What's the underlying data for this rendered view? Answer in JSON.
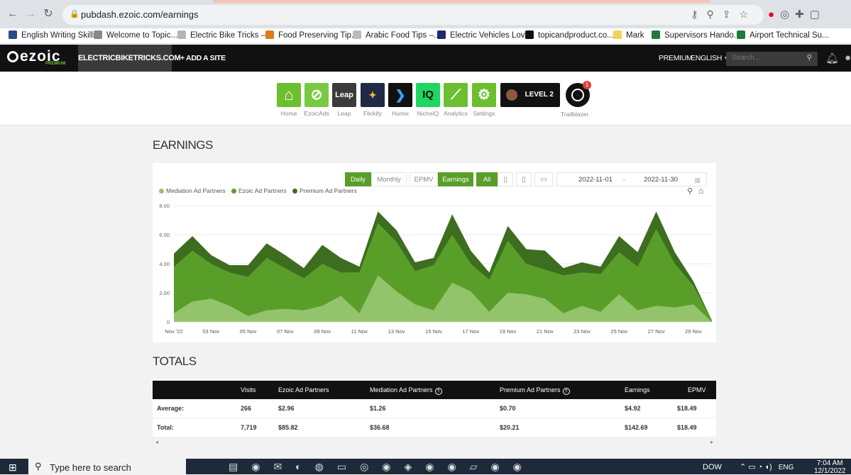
{
  "browser": {
    "url": "pubdash.ezoic.com/earnings",
    "bookmarks": [
      {
        "label": "English Writing Skills",
        "color": "#2b4a8a"
      },
      {
        "label": "Welcome to Topic...",
        "color": "#888888"
      },
      {
        "label": "Electric Bike Tricks –...",
        "color": "#b5b5b5"
      },
      {
        "label": "Food Preserving Tip...",
        "color": "#e07b1c"
      },
      {
        "label": "Arabic Food Tips –...",
        "color": "#bbbbbb"
      },
      {
        "label": "Electric Vehicles Lov...",
        "color": "#1d2b6b"
      },
      {
        "label": "topicandproduct.co...",
        "color": "#111111"
      },
      {
        "label": "Mark",
        "color": "#f2d35a"
      },
      {
        "label": "Supervisors Hando...",
        "color": "#1e7b3c"
      },
      {
        "label": "Airport Technical Su...",
        "color": "#1e7b3c"
      }
    ]
  },
  "header": {
    "logo": "ezoic",
    "logo_sub": "PREMIUM",
    "site": "ELECTRICBIKETRICKS.COM",
    "add_site": "+ ADD A SITE",
    "premium": "PREMIUM",
    "language": "ENGLISH",
    "search_placeholder": "Search..."
  },
  "apps": [
    {
      "label": "Home",
      "color": "#6cbf2f",
      "icon": "home-icon",
      "glyph": "⌂"
    },
    {
      "label": "EzoicAds",
      "color": "#7ac943",
      "icon": "ads-icon",
      "glyph": "⊘"
    },
    {
      "label": "Leap",
      "color": "#3b3b3b",
      "icon": "leap-icon",
      "glyph": "Leap"
    },
    {
      "label": "Flickify",
      "color": "#1f2a44",
      "icon": "flickify-icon",
      "glyph": "✦"
    },
    {
      "label": "Humix",
      "color": "#111111",
      "icon": "humix-icon",
      "glyph": "❯"
    },
    {
      "label": "NicheIQ",
      "color": "#1ed760",
      "icon": "nicheiq-icon",
      "glyph": "IQ"
    },
    {
      "label": "Analytics",
      "color": "#6cbf2f",
      "icon": "analytics-icon",
      "glyph": "⟋"
    },
    {
      "label": "Settings",
      "color": "#6cbf2f",
      "icon": "settings-icon",
      "glyph": "⚙"
    }
  ],
  "level_badge": "LEVEL 2",
  "trailblazer": {
    "label": "Trailblazer",
    "badge": "1"
  },
  "earnings": {
    "title": "EARNINGS",
    "controls": {
      "daily": "Daily",
      "monthly": "Monthly",
      "epmv": "EPMV",
      "earnings": "Earnings",
      "all": "All",
      "date_from": "2022-11-01",
      "date_sep": "–",
      "date_to": "2022-11-30"
    }
  },
  "chart_data": {
    "type": "area",
    "stacked": true,
    "colors": {
      "mediation": "#93c46b",
      "ezoic": "#5a9e2a",
      "premium": "#3d6e1f"
    },
    "legend_placement": "top-left",
    "ylim": [
      0,
      8
    ],
    "yticks": [
      "8.00",
      "6.00",
      "4.00",
      "2.00",
      "0"
    ],
    "xtick_labels": [
      "Nov '22",
      "03 Nov",
      "05 Nov",
      "07 Nov",
      "09 Nov",
      "11 Nov",
      "13 Nov",
      "15 Nov",
      "17 Nov",
      "19 Nov",
      "21 Nov",
      "23 Nov",
      "25 Nov",
      "27 Nov",
      "29 Nov"
    ],
    "x": [
      "2022-11-01",
      "2022-11-02",
      "2022-11-03",
      "2022-11-04",
      "2022-11-05",
      "2022-11-06",
      "2022-11-07",
      "2022-11-08",
      "2022-11-09",
      "2022-11-10",
      "2022-11-11",
      "2022-11-12",
      "2022-11-13",
      "2022-11-14",
      "2022-11-15",
      "2022-11-16",
      "2022-11-17",
      "2022-11-18",
      "2022-11-19",
      "2022-11-20",
      "2022-11-21",
      "2022-11-22",
      "2022-11-23",
      "2022-11-24",
      "2022-11-25",
      "2022-11-26",
      "2022-11-27",
      "2022-11-28",
      "2022-11-29",
      "2022-11-30"
    ],
    "series": [
      {
        "name": "Mediation Ad Partners",
        "values": [
          0.6,
          1.4,
          1.6,
          1.1,
          0.4,
          0.8,
          0.9,
          0.8,
          1.1,
          1.8,
          0.6,
          3.2,
          2.1,
          1.2,
          0.8,
          2.7,
          2.1,
          0.7,
          2.0,
          1.9,
          1.6,
          0.6,
          1.1,
          0.7,
          1.9,
          0.8,
          1.1,
          1.0,
          1.2,
          0.0
        ]
      },
      {
        "name": "Ezoic Ad Partners",
        "values": [
          3.2,
          3.5,
          2.4,
          2.3,
          2.7,
          3.6,
          2.8,
          2.2,
          2.9,
          1.6,
          2.8,
          3.6,
          3.4,
          2.3,
          3.1,
          3.3,
          1.9,
          2.2,
          3.6,
          2.1,
          2.0,
          2.6,
          2.3,
          2.6,
          2.9,
          3.0,
          5.3,
          3.0,
          1.3,
          0.1
        ]
      },
      {
        "name": "Premium Ad Partners",
        "values": [
          0.9,
          1.0,
          0.6,
          0.5,
          0.8,
          1.0,
          0.9,
          0.7,
          1.3,
          1.0,
          0.4,
          0.8,
          0.8,
          0.6,
          0.5,
          1.4,
          0.9,
          0.5,
          1.0,
          1.0,
          1.3,
          0.5,
          0.7,
          0.5,
          1.1,
          1.0,
          1.2,
          0.8,
          0.3,
          0.0
        ]
      }
    ]
  },
  "totals": {
    "title": "TOTALS",
    "headers": [
      "Visits",
      "Ezoic Ad Partners",
      "Mediation Ad Partners",
      "Premium Ad Partners",
      "Earnings",
      "EPMV"
    ],
    "rows": [
      {
        "label": "Average:",
        "values": [
          "266",
          "$2.96",
          "$1.26",
          "$0.70",
          "$4.92",
          "$18.49"
        ]
      },
      {
        "label": "Total:",
        "values": [
          "7,719",
          "$85.82",
          "$36.68",
          "$20.21",
          "$142.69",
          "$18.49"
        ]
      }
    ]
  },
  "taskbar": {
    "search": "Type here to search",
    "tray_label": "DOW",
    "lang": "ENG",
    "time": "7:04 AM",
    "date": "12/1/2022"
  }
}
